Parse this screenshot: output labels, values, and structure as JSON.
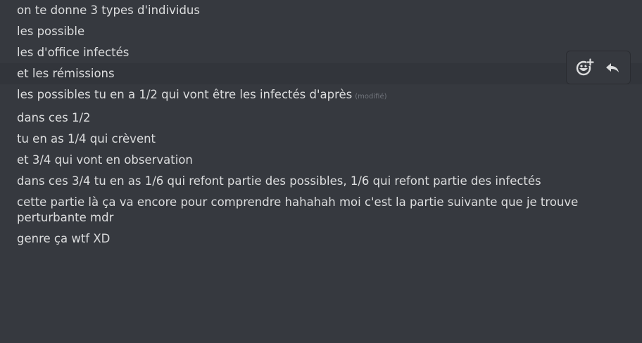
{
  "messages": [
    {
      "text": "on te donne 3 types d'individus"
    },
    {
      "text": "les possible"
    },
    {
      "text": "les d'office infectés"
    },
    {
      "text": "et les rémissions"
    },
    {
      "text": "les possibles tu en a 1/2 qui vont être les infectés d'après",
      "edited": "(modifié)"
    },
    {
      "text": "dans ces 1/2"
    },
    {
      "text": "tu en as 1/4 qui crèvent"
    },
    {
      "text": "et 3/4 qui vont en observation"
    },
    {
      "text": "dans ces 3/4 tu en as 1/6 qui refont partie des possibles, 1/6 qui refont partie des infectés"
    },
    {
      "text": "cette partie là ça va encore pour comprendre hahahah moi c'est la partie suivante que je trouve perturbante mdr"
    },
    {
      "text": "genre ça wtf XD"
    }
  ],
  "toolbar": {
    "icons": [
      "add-reaction-icon",
      "reply-icon"
    ]
  },
  "colors": {
    "background": "#36393f",
    "hover_row": "#32353b",
    "text": "#dcddde",
    "muted": "#72767d"
  }
}
